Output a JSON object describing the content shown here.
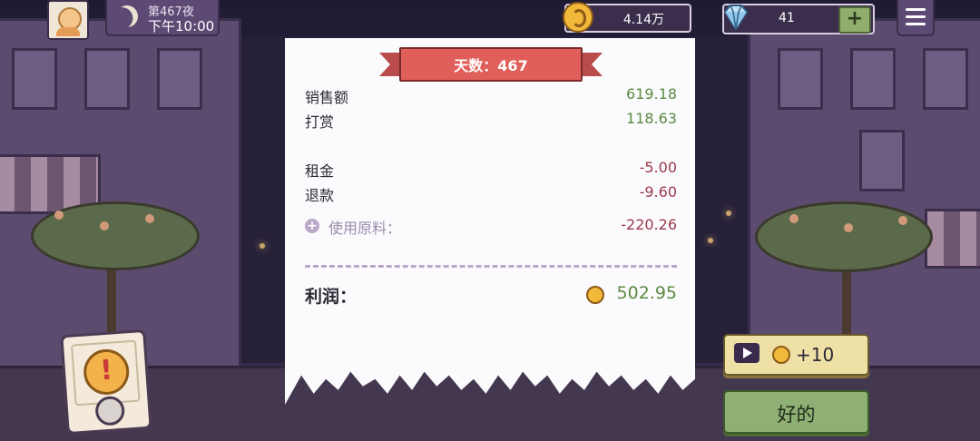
{
  "hud": {
    "night_label": "第467夜",
    "time_label": "下午10:00",
    "coins": "4.14万",
    "gems": "41",
    "add_symbol": "+"
  },
  "receipt": {
    "day_label": "天数：467",
    "sales_label": "销售额",
    "sales_value": "619.18",
    "tips_label": "打赏",
    "tips_value": "118.63",
    "rent_label": "租金",
    "rent_value": "-5.00",
    "refund_label": "退款",
    "refund_value": "-9.60",
    "materials_label": "使用原料：",
    "materials_value": "-220.26",
    "profit_label": "利润：",
    "profit_value": "502.95"
  },
  "buttons": {
    "ad_reward": "+10",
    "ok_label": "好的"
  },
  "alert": {
    "symbol": "!"
  },
  "colors": {
    "positive": "#5c8a42",
    "negative": "#9a3a4a",
    "ribbon": "#e05f5a",
    "ok_button": "#8fb074",
    "ad_button": "#efe0a6"
  }
}
